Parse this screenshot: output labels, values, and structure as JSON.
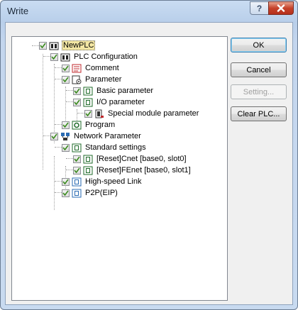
{
  "window": {
    "title": "Write"
  },
  "buttons": {
    "ok": "OK",
    "cancel": "Cancel",
    "setting": "Setting...",
    "clear_plc": "Clear PLC..."
  },
  "tree": {
    "root": "NewPLC",
    "plc_config": "PLC Configuration",
    "comment": "Comment",
    "parameter": "Parameter",
    "basic_param": "Basic parameter",
    "io_param": "I/O parameter",
    "special_module": "Special module parameter",
    "program": "Program",
    "network_param": "Network Parameter",
    "standard_settings": "Standard settings",
    "cnet": "[Reset]Cnet [base0, slot0]",
    "fenet": "[Reset]FEnet [base0, slot1]",
    "high_speed": "High-speed Link",
    "p2p": "P2P(EIP)"
  },
  "icons": {
    "help": "help-icon",
    "close": "close-icon",
    "checkbox": "checkmark-icon",
    "plc": "plc-icon",
    "comment": "comment-icon",
    "parameter": "parameter-icon",
    "module": "module-icon",
    "program": "program-icon",
    "network": "network-icon"
  },
  "colors": {
    "title_gradient_top": "#c9dcf2",
    "close_button": "#c6422a",
    "selection": "#f3e6a3",
    "checkmark": "#3a8a1e"
  }
}
